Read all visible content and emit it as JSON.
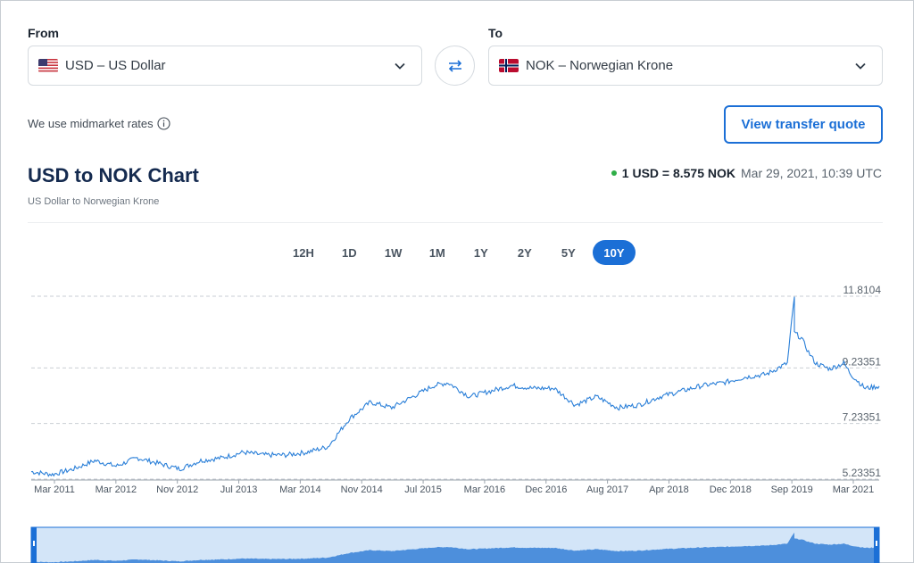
{
  "converter": {
    "from_label": "From",
    "to_label": "To",
    "from_value": "USD – US Dollar",
    "to_value": "NOK – Norwegian Krone",
    "from_flag": "us-flag",
    "to_flag": "norway-flag"
  },
  "midmarket_text": "We use midmarket rates",
  "quote_button": "View transfer quote",
  "chart_header": {
    "title": "USD to NOK Chart",
    "subtitle": "US Dollar to Norwegian Krone",
    "rate": "1 USD = 8.575 NOK",
    "timestamp": "Mar 29, 2021, 10:39 UTC",
    "status_color": "#2fae47"
  },
  "ranges": [
    "12H",
    "1D",
    "1W",
    "1M",
    "1Y",
    "2Y",
    "5Y",
    "10Y"
  ],
  "active_range": "10Y",
  "colors": {
    "accent": "#1b6fd6",
    "line": "#2a7fd8",
    "navigator_fill": "#4d8fdc"
  },
  "chart_data": {
    "type": "line",
    "title": "USD to NOK Chart",
    "x_ticks": [
      "Mar 2011",
      "Mar 2012",
      "Nov 2012",
      "Jul 2013",
      "Mar 2014",
      "Nov 2014",
      "Jul 2015",
      "Mar 2016",
      "Dec 2016",
      "Aug 2017",
      "Apr 2018",
      "Dec 2018",
      "Sep 2019",
      "Mar 2021"
    ],
    "y_ticks": [
      "11.8104",
      "9.23351",
      "7.23351",
      "5.23351"
    ],
    "ylim": [
      5.23351,
      11.8104
    ],
    "grid": "horizontal-dashed",
    "series": [
      {
        "x": [
          "2011-03",
          "2011-06",
          "2011-09",
          "2011-12",
          "2012-03",
          "2012-06",
          "2012-09",
          "2012-12",
          "2013-03",
          "2013-06",
          "2013-09",
          "2013-12",
          "2014-03",
          "2014-06",
          "2014-09",
          "2014-12",
          "2015-01",
          "2015-03",
          "2015-06",
          "2015-09",
          "2015-12",
          "2016-02",
          "2016-05",
          "2016-08",
          "2016-11",
          "2017-02",
          "2017-05",
          "2017-08",
          "2017-11",
          "2018-02",
          "2018-05",
          "2018-08",
          "2018-11",
          "2019-02",
          "2019-05",
          "2019-08",
          "2019-11",
          "2020-02",
          "2020-03",
          "2020-03",
          "2020-04",
          "2020-05",
          "2020-06",
          "2020-08",
          "2020-10",
          "2020-11",
          "2021-01",
          "2021-03"
        ],
        "values": [
          5.5,
          5.4,
          5.6,
          5.9,
          5.7,
          6.0,
          5.8,
          5.6,
          5.9,
          6.0,
          6.2,
          6.1,
          6.1,
          6.2,
          6.4,
          7.4,
          7.6,
          8.0,
          7.8,
          8.2,
          8.6,
          8.7,
          8.2,
          8.4,
          8.6,
          8.5,
          8.5,
          7.9,
          8.2,
          7.8,
          7.9,
          8.2,
          8.4,
          8.6,
          8.7,
          8.9,
          9.0,
          9.4,
          11.8104,
          10.5,
          10.3,
          9.8,
          9.4,
          9.2,
          9.4,
          9.0,
          8.5,
          8.575
        ]
      }
    ]
  }
}
